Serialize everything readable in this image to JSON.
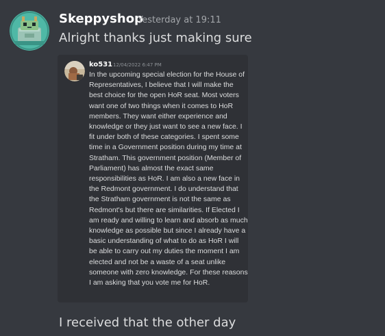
{
  "message_group": {
    "author": "Skeppyshop",
    "timestamp": "Yesterday at 19:11",
    "avatar_icon": "robot-avatar",
    "messages": [
      "Alright thanks just making sure"
    ]
  },
  "embed": {
    "author": "ko531",
    "timestamp": "12/04/2022 6:47 PM",
    "avatar_icon": "user-photo-avatar",
    "text": "In the upcoming special election for the House of Representatives, I believe that I will make the best choice for the open HoR seat. Most voters want one of two things when it comes to HoR members. They want either experience and knowledge or they just want to see a new face. I fit under both of these categories. I spent some time in a Government position during my time at Stratham. This government position (Member of Parliament) has almost the exact same responsibilities as HoR. I am also a new face in the Redmont government. I do understand that the Stratham government is not the same as Redmont's but there are similarities. If Elected I am ready and willing to learn and absorb as much knowledge as possible but since I already have a basic understanding of what to do as HoR I will be able to carry out my duties the moment I am elected and not be a waste of a seat unlike someone with zero knowledge. For these reasons I am asking that you vote me for HoR."
  },
  "followup_message": "I received that the other day",
  "colors": {
    "background": "#36393f",
    "embed_background": "#2f3136",
    "username": "#ffffff",
    "message_text": "#dcddde",
    "timestamp": "#a3a6aa",
    "avatar_teal": "#4fb8a6"
  }
}
